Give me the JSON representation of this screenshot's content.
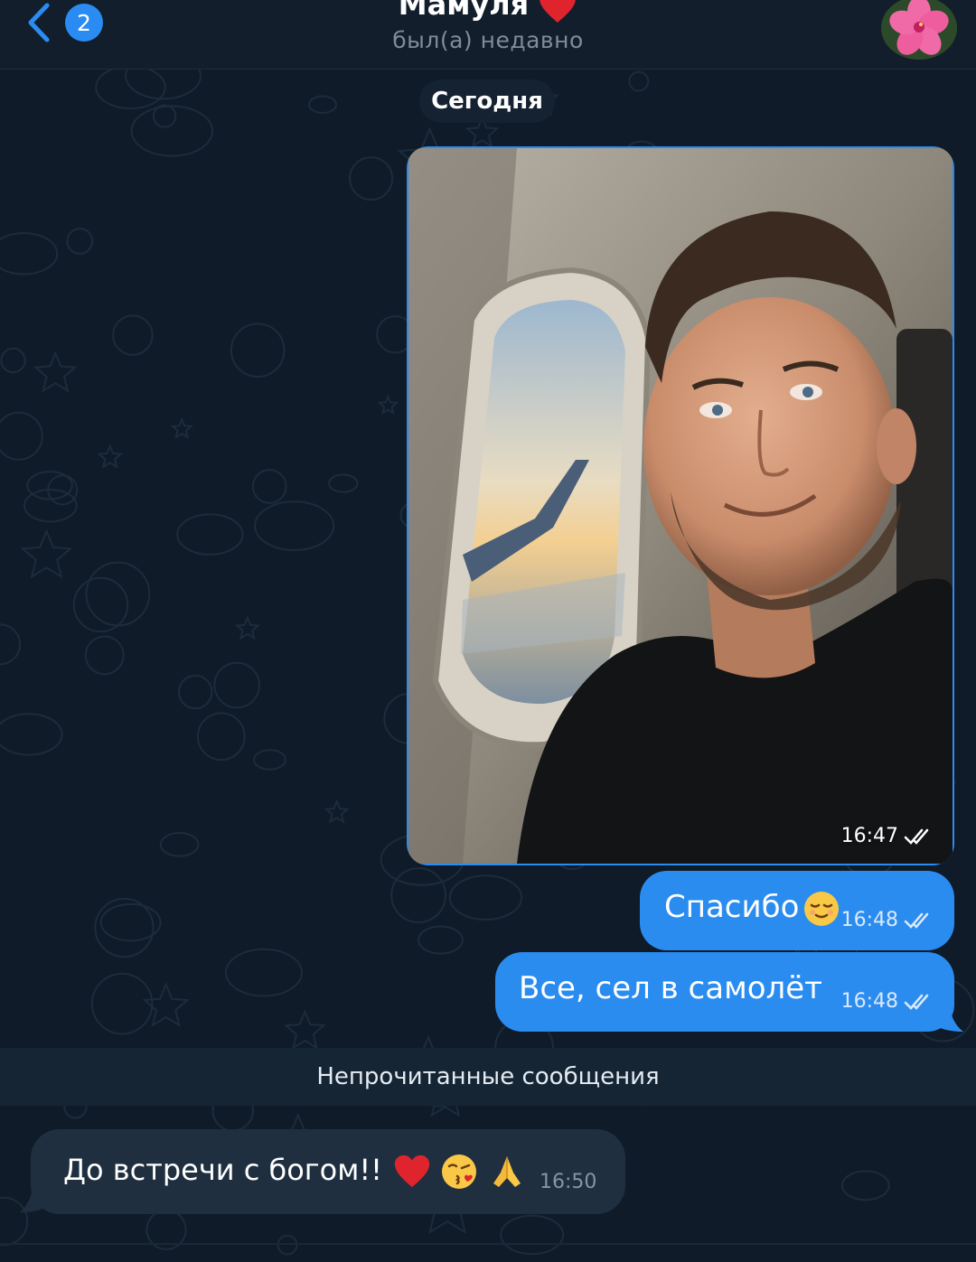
{
  "header": {
    "back_badge_count": "2",
    "contact_name": "Мамуля",
    "status": "был(а) недавно"
  },
  "date_separator": "Сегодня",
  "messages": [
    {
      "type": "photo",
      "direction": "outgoing",
      "time": "16:47",
      "read": true,
      "icon": "double-check-icon"
    },
    {
      "type": "text",
      "direction": "outgoing",
      "text": "Спасибо",
      "emoji": "relieved-face-emoji",
      "time": "16:48",
      "read": true
    },
    {
      "type": "text",
      "direction": "outgoing",
      "text": "Все, сел в самолёт",
      "time": "16:48",
      "read": true
    }
  ],
  "unread_divider": "Непрочитанные сообщения",
  "incoming": {
    "text": "До встречи с богом!!",
    "emojis": [
      "red-heart-emoji",
      "face-blowing-kiss-emoji",
      "folded-hands-emoji"
    ],
    "time": "16:50"
  },
  "colors": {
    "background": "#0f1b28",
    "outgoing_bubble": "#2b8cf0",
    "incoming_bubble": "#1f2f40",
    "accent": "#2a8cf2"
  }
}
